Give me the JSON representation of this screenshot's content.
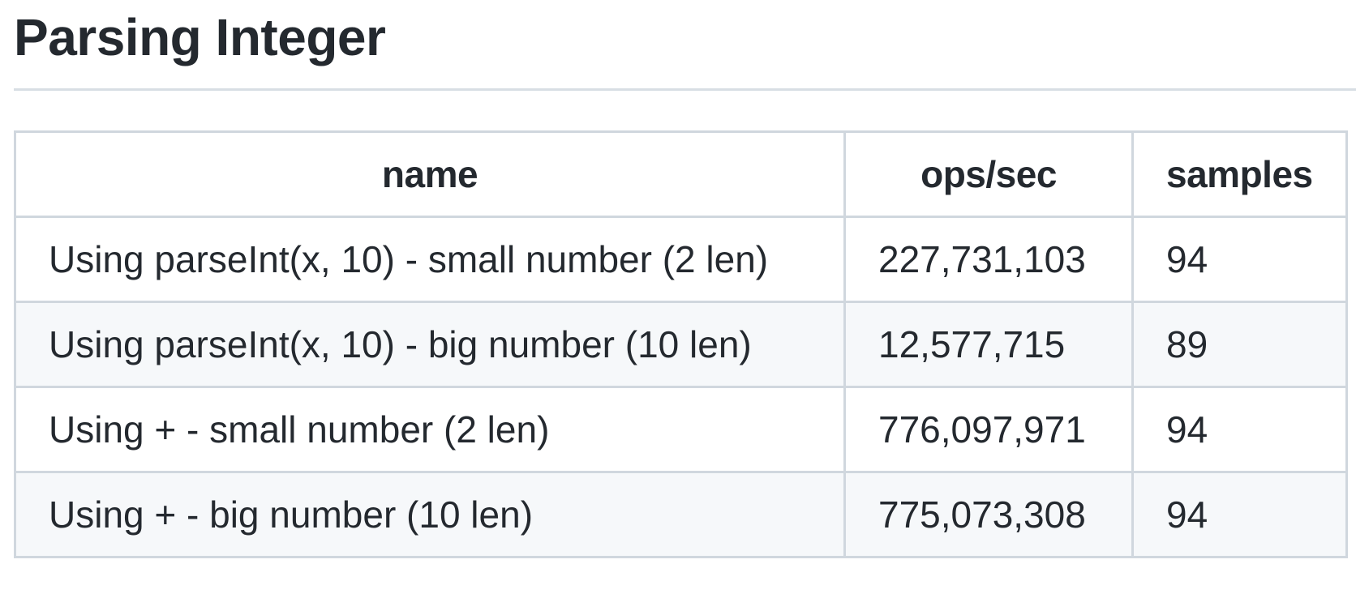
{
  "title": "Parsing Integer",
  "table": {
    "headers": [
      "name",
      "ops/sec",
      "samples"
    ],
    "rows": [
      {
        "name": "Using parseInt(x, 10) - small number (2 len)",
        "ops": "227,731,103",
        "samples": "94"
      },
      {
        "name": "Using parseInt(x, 10) - big number (10 len)",
        "ops": "12,577,715",
        "samples": "89"
      },
      {
        "name": "Using + - small number (2 len)",
        "ops": "776,097,971",
        "samples": "94"
      },
      {
        "name": "Using + - big number (10 len)",
        "ops": "775,073,308",
        "samples": "94"
      }
    ]
  }
}
